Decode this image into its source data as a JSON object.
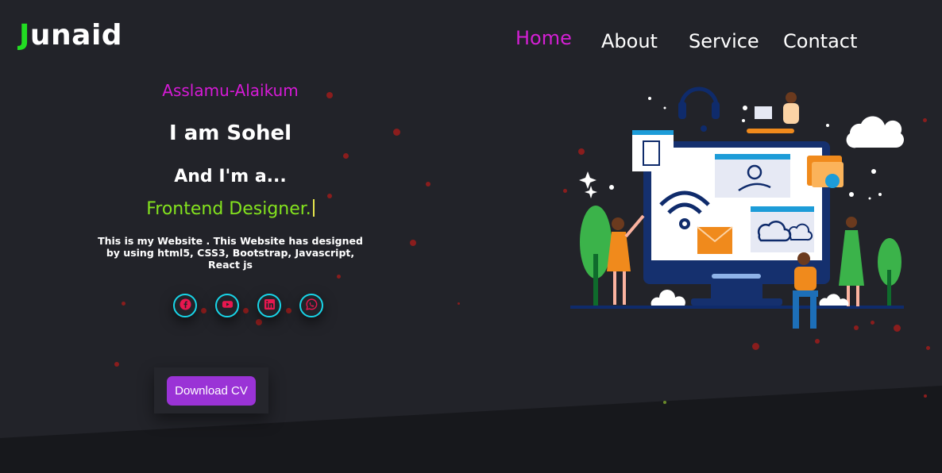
{
  "header": {
    "logo_first": "J",
    "logo_rest": "unaid",
    "nav": [
      {
        "label": "Home",
        "active": true
      },
      {
        "label": "About",
        "active": false
      },
      {
        "label": "Service",
        "active": false
      },
      {
        "label": "Contact",
        "active": false
      }
    ]
  },
  "hero": {
    "greeting": "Asslamu-Alaikum",
    "name": "I am Sohel",
    "intro": "And I'm a...",
    "role": "Frontend Designer.",
    "description": "This is my Website . This Website has designed by using html5, CSS3, Bootstrap, Javascript, React js",
    "socials": [
      {
        "icon": "facebook-icon"
      },
      {
        "icon": "youtube-icon"
      },
      {
        "icon": "linkedin-icon"
      },
      {
        "icon": "whatsapp-icon"
      }
    ],
    "cta_label": "Download CV"
  },
  "colors": {
    "background": "#222329",
    "accent_pink": "#d41fd4",
    "logo_green": "#22dd22",
    "role_green": "#84e31e",
    "social_ring": "#18d5e8",
    "social_icon": "#e8174f",
    "button": "#9a33d6"
  }
}
